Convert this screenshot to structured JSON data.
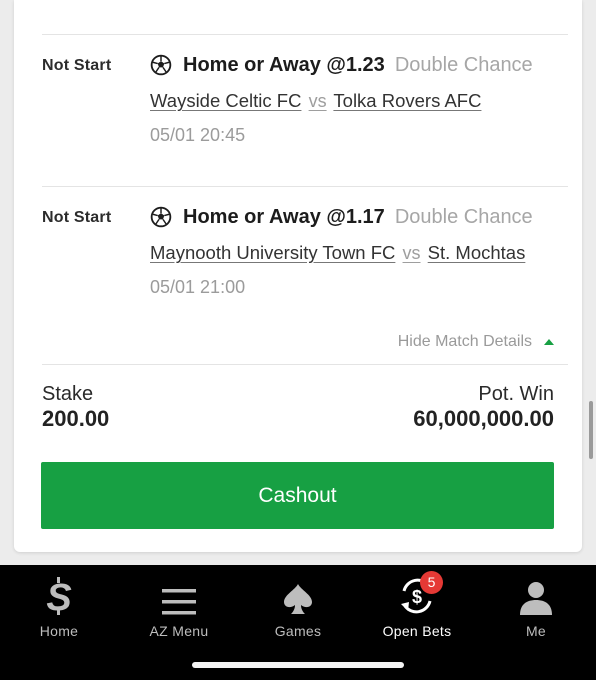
{
  "bets": [
    {
      "status": "Not Start",
      "selection": "Home or Away @1.23",
      "market": "Double Chance",
      "home_team": "Wayside Celtic FC",
      "vs": "vs",
      "away_team": "Tolka Rovers AFC",
      "datetime": "05/01 20:45"
    },
    {
      "status": "Not Start",
      "selection": "Home or Away @1.17",
      "market": "Double Chance",
      "home_team": "Maynooth University Town FC",
      "vs": "vs",
      "away_team": "St. Mochtas",
      "datetime": "05/01 21:00"
    }
  ],
  "details_toggle": "Hide Match Details",
  "summary": {
    "stake_label": "Stake",
    "stake_value": "200.00",
    "win_label": "Pot. Win",
    "win_value": "60,000,000.00"
  },
  "cashout_label": "Cashout",
  "tabbar": {
    "items": [
      {
        "label": "Home",
        "icon": "sportybet-s-icon"
      },
      {
        "label": "AZ Menu",
        "icon": "hamburger-menu-icon"
      },
      {
        "label": "Games",
        "icon": "spade-icon"
      },
      {
        "label": "Open Bets",
        "icon": "cashout-coin-icon",
        "badge": "5",
        "active": true
      },
      {
        "label": "Me",
        "icon": "user-icon"
      }
    ]
  },
  "colors": {
    "accent_green": "#17a043",
    "badge_red": "#e53935",
    "tabbar_bg": "#000000"
  }
}
